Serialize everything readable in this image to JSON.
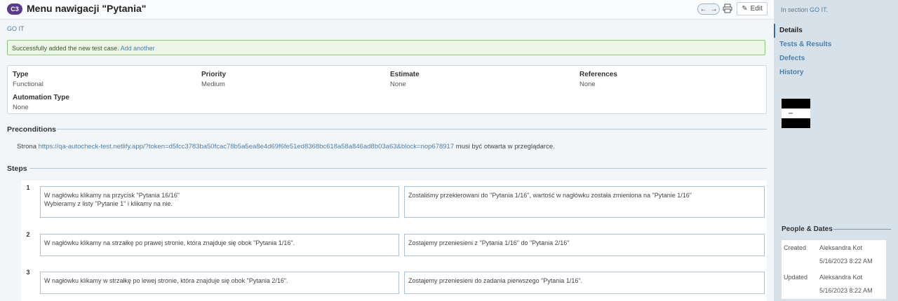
{
  "header": {
    "badge": "C3",
    "title": "Menu nawigacji \"Pytania\"",
    "edit_label": "Edit",
    "prev_icon": "arrow-left-icon",
    "next_icon": "arrow-right-icon",
    "print_icon": "print-icon"
  },
  "breadcrumb": "GO IT",
  "success": {
    "message": "Successfully added the new test case.",
    "link": "Add another"
  },
  "fields": {
    "type": {
      "label": "Type",
      "value": "Functional"
    },
    "priority": {
      "label": "Priority",
      "value": "Medium"
    },
    "estimate": {
      "label": "Estimate",
      "value": "None"
    },
    "references": {
      "label": "References",
      "value": "None"
    },
    "automation": {
      "label": "Automation Type",
      "value": "None"
    }
  },
  "preconditions": {
    "heading": "Preconditions",
    "prefix": "Strona",
    "url": "https://qa-autocheck-test.netlify.app/?token=d5fcc3783ba50fcac78b5a5ea8e4d69f6fe51ed8368bc618a58a846ad8b03a63&block=nop678917",
    "suffix": "musi być otwarta w przeglądarce."
  },
  "steps": {
    "heading": "Steps",
    "items": [
      {
        "num": "1",
        "action_line1": "W nagłówku klikamy na przycisk \"Pytania 16/16\"",
        "action_line2": "Wybieramy z listy \"Pytanie 1\" i klikamy na nie.",
        "expected": "Zostaliśmy przekierowani do \"Pytania 1/16\", wartość w nagłówku została zmieniona na \"Pytanie 1/16\""
      },
      {
        "num": "2",
        "action_line1": "W nagłówku klikamy na strzałkę po prawej stronie, która znajduje się obok \"Pytania 1/16\".",
        "action_line2": "",
        "expected": "Zostajemy przeniesieni z \"Pytania 1/16\" do \"Pytania 2/16\""
      },
      {
        "num": "3",
        "action_line1": "W nagłówku klikamy w strzałkę po lewej stronie, która znajduje się obok \"Pytania 2/16\".",
        "action_line2": "",
        "expected": "Zostajemy przeniesieni do zadania pierwszego \"Pytania 1/16\"."
      }
    ]
  },
  "sidebar": {
    "in_section_prefix": "In section",
    "in_section_link": "GO IT.",
    "nav": [
      "Details",
      "Tests & Results",
      "Defects",
      "History"
    ],
    "people_dates": {
      "heading": "People & Dates",
      "created_label": "Created",
      "created_by": "Aleksandra Kot",
      "created_at": "5/16/2023 8:22 AM",
      "updated_label": "Updated",
      "updated_by": "Aleksandra Kot",
      "updated_at": "5/16/2023 8:22 AM"
    }
  }
}
